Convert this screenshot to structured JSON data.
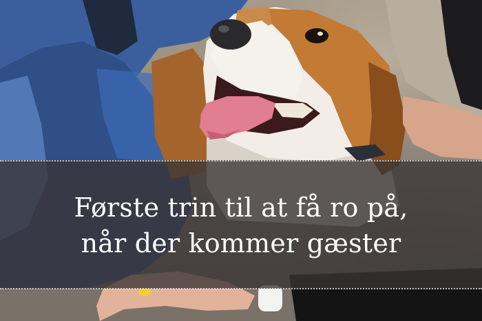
{
  "banner": {
    "title_line_1": "Første trin til at få ro på,",
    "title_line_2": "når der kommer gæster"
  },
  "colors": {
    "banner_overlay": "#3a3434",
    "title_text": "#ffffff",
    "dotted_rule": "#e6e2dc"
  },
  "photo": {
    "subject": "beagle-dog",
    "elements": [
      "person-in-blue-shirt",
      "beagle-head",
      "tongue",
      "human-hands",
      "wristwatch",
      "yellow-nail"
    ]
  }
}
